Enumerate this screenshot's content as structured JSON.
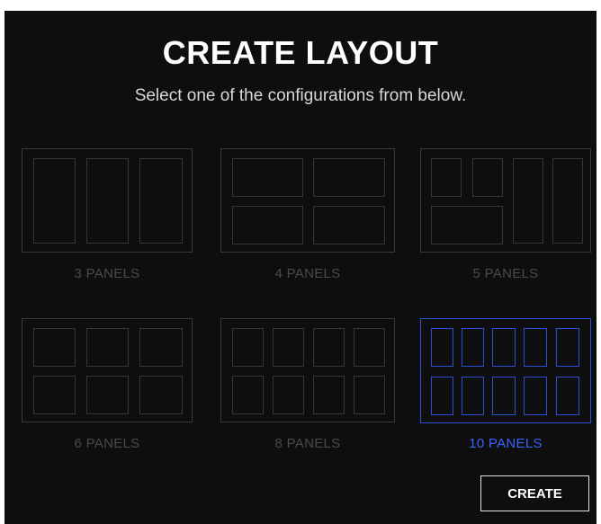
{
  "dialog": {
    "title": "CREATE LAYOUT",
    "subtitle": "Select one of the configurations from below."
  },
  "layouts": [
    {
      "label": "3 PANELS",
      "panels": 3,
      "selected": false
    },
    {
      "label": "4 PANELS",
      "panels": 4,
      "selected": false
    },
    {
      "label": "5 PANELS",
      "panels": 5,
      "selected": false
    },
    {
      "label": "6 PANELS",
      "panels": 6,
      "selected": false
    },
    {
      "label": "8 PANELS",
      "panels": 8,
      "selected": false
    },
    {
      "label": "10 PANELS",
      "panels": 10,
      "selected": true
    }
  ],
  "actions": {
    "create_label": "CREATE"
  },
  "colors": {
    "background": "#0e0e0e",
    "thumbnail_border": "#3a3a3a",
    "selected_accent": "#2d4fd6",
    "selected_label": "#3a64ff",
    "inactive_label": "#4a4a4a"
  }
}
